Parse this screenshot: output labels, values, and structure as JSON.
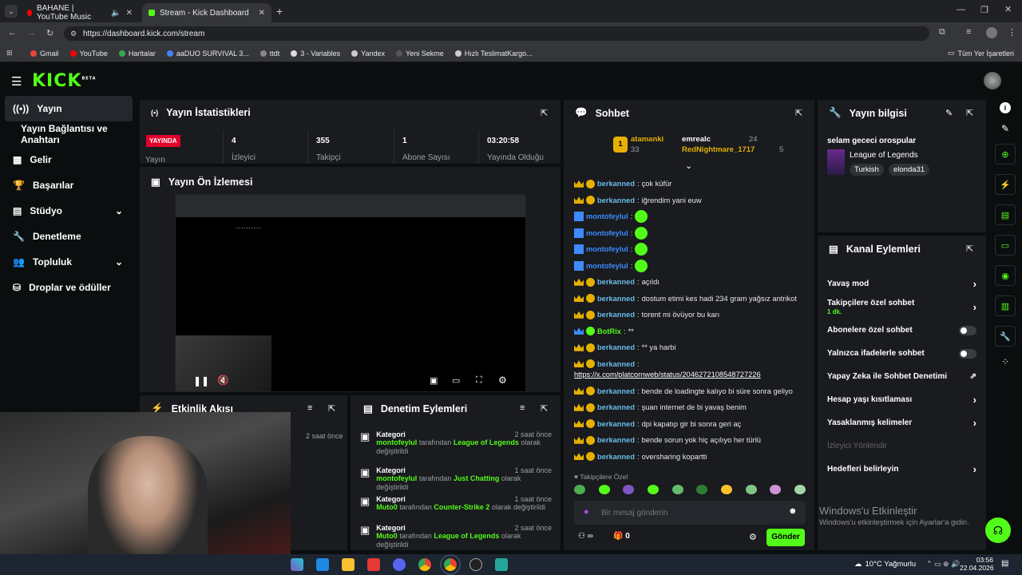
{
  "browser": {
    "tabs": [
      {
        "label": "BAHANE | YouTube Music",
        "color": "#ff0000"
      },
      {
        "label": "Stream - Kick Dashboard",
        "color": "#53fc18"
      }
    ],
    "url": "https://dashboard.kick.com/stream",
    "bookmarks": [
      "Gmail",
      "YouTube",
      "Haritalar",
      "aaDUO SURVIVAL 3...",
      "ttdt",
      "3 - Variables",
      "Yandex",
      "Yeni Sekme",
      "Hızlı TeslimatKargo..."
    ],
    "all_bookmarks": "Tüm Yer İşaretleri"
  },
  "header": {
    "logo": "KICK",
    "beta": "BETA"
  },
  "sidebar": {
    "items": [
      {
        "label": "Yayın"
      },
      {
        "label": "Yayın Bağlantısı ve Anahtarı"
      },
      {
        "label": "Gelir"
      },
      {
        "label": "Başarılar"
      },
      {
        "label": "Stüdyo"
      },
      {
        "label": "Denetleme"
      },
      {
        "label": "Topluluk"
      },
      {
        "label": "Droplar ve ödüller"
      }
    ]
  },
  "stats": {
    "title": "Yayın İstatistikleri",
    "live_badge": "YAYINDA",
    "stream_label": "Yayın",
    "cells": [
      {
        "value": "4",
        "label": "İzleyici"
      },
      {
        "value": "355",
        "label": "Takipçi"
      },
      {
        "value": "1",
        "label": "Abone Sayısı"
      },
      {
        "value": "03:20:58",
        "label": "Yayında Olduğu"
      }
    ]
  },
  "preview": {
    "title": "Yayın Ön İzlemesi"
  },
  "activity": {
    "title": "Etkinlik Akışı",
    "time": "2 saat önce"
  },
  "moderation": {
    "title": "Denetim Eylemleri",
    "items": [
      {
        "title": "Kategori",
        "time": "2 saat önce",
        "user": "montofeylul",
        "mid": "tarafından",
        "target": "League of Legends",
        "end": "olarak değiştirildi"
      },
      {
        "title": "Kategori",
        "time": "1 saat önce",
        "user": "montofeylul",
        "mid": "tarafından",
        "target": "Just Chatting",
        "end": "olarak değiştirildi"
      },
      {
        "title": "Kategori",
        "time": "1 saat önce",
        "user": "Muto0",
        "mid": "tarafından",
        "target": "Counter-Strike 2",
        "end": "olarak değiştirildi"
      },
      {
        "title": "Kategori",
        "time": "2 saat önce",
        "user": "Muto0",
        "mid": "tarafından",
        "target": "League of Legends",
        "end": "olarak değiştirildi"
      }
    ]
  },
  "chat": {
    "title": "Sohbet",
    "top": {
      "user1": "atamanki",
      "count1": "33",
      "user2": "emrealc",
      "count2": "24",
      "user3": "RedNightmare_1717",
      "count3": "5"
    },
    "messages": [
      {
        "user": "berkanned",
        "text": "çok küfür",
        "color": "#6bbbe8"
      },
      {
        "user": "berkanned",
        "text": "iğrendim yani euw",
        "color": "#6bbbe8"
      },
      {
        "user": "montofeylul",
        "text": "",
        "color": "#3d8bff",
        "emote": true
      },
      {
        "user": "montofeylul",
        "text": "",
        "color": "#3d8bff",
        "emote": true
      },
      {
        "user": "montofeylul",
        "text": "",
        "color": "#3d8bff",
        "emote": true
      },
      {
        "user": "montofeylul",
        "text": "",
        "color": "#3d8bff",
        "emote": true
      },
      {
        "user": "berkanned",
        "text": "açıldı",
        "color": "#6bbbe8"
      },
      {
        "user": "berkanned",
        "text": "dostum etimi kes hadi 234 gram yağsız antrikot",
        "color": "#6bbbe8"
      },
      {
        "user": "berkanned",
        "text": "torent mi övüyor bu karı",
        "color": "#6bbbe8"
      },
      {
        "user": "BotRix",
        "text": "**",
        "color": "#53fc18"
      },
      {
        "user": "berkanned",
        "text": "** ya harbi",
        "color": "#6bbbe8"
      },
      {
        "user": "berkanned",
        "text": "",
        "color": "#6bbbe8"
      },
      {
        "user": "",
        "text": "https://x.com/platcornweb/status/2046272108548727226",
        "color": "#6bbbe8",
        "link": true
      },
      {
        "user": "berkanned",
        "text": "bende de loadingte kalıyo bi süre sonra geliyo",
        "color": "#6bbbe8"
      },
      {
        "user": "berkanned",
        "text": "şuan internet de bi yavaş benim",
        "color": "#6bbbe8"
      },
      {
        "user": "berkanned",
        "text": "dpi kapatıp gir bi sonra geri aç",
        "color": "#6bbbe8"
      },
      {
        "user": "berkanned",
        "text": "bende sorun yok hiç açılıyo her türlü",
        "color": "#6bbbe8"
      },
      {
        "user": "berkanned",
        "text": "oversharing kopartti",
        "color": "#6bbbe8"
      }
    ],
    "followers_only": "Takipçilere Özel",
    "input_placeholder": "Bir mesaj gönderin",
    "infinity": "∞",
    "zero": "0",
    "send": "Gönder"
  },
  "info": {
    "title": "Yayın bilgisi",
    "stream_title": "selam gececi orospular",
    "category": "League of Legends",
    "tags": [
      "Turkish",
      "elonda31"
    ]
  },
  "channel": {
    "title": "Kanal Eylemleri",
    "actions": [
      {
        "label": "Yavaş mod",
        "type": "arrow"
      },
      {
        "label": "Takipçilere özel sohbet",
        "sub": "1 dk.",
        "type": "arrow"
      },
      {
        "label": "Abonelere özel sohbet",
        "type": "toggle"
      },
      {
        "label": "Yalnızca ifadelerle sohbet",
        "type": "toggle"
      },
      {
        "label": "Yapay Zeka ile Sohbet Denetimi",
        "type": "ext"
      },
      {
        "label": "Hesap yaşı kısıtlaması",
        "type": "arrow"
      },
      {
        "label": "Yasaklanmış kelimeler",
        "type": "arrow"
      },
      {
        "label": "İzleyici Yönlendir",
        "type": "disabled"
      },
      {
        "label": "Hedefleri belirleyin",
        "type": "arrow"
      }
    ]
  },
  "windows": {
    "activate": "Windows'u Etkinleştir",
    "activate_sub": "Windows'u etkinleştirmek için Ayarlar'a gidin."
  },
  "taskbar": {
    "weather": "10°C  Yağmurlu",
    "time": "03:56",
    "date": "22.04.2026"
  }
}
